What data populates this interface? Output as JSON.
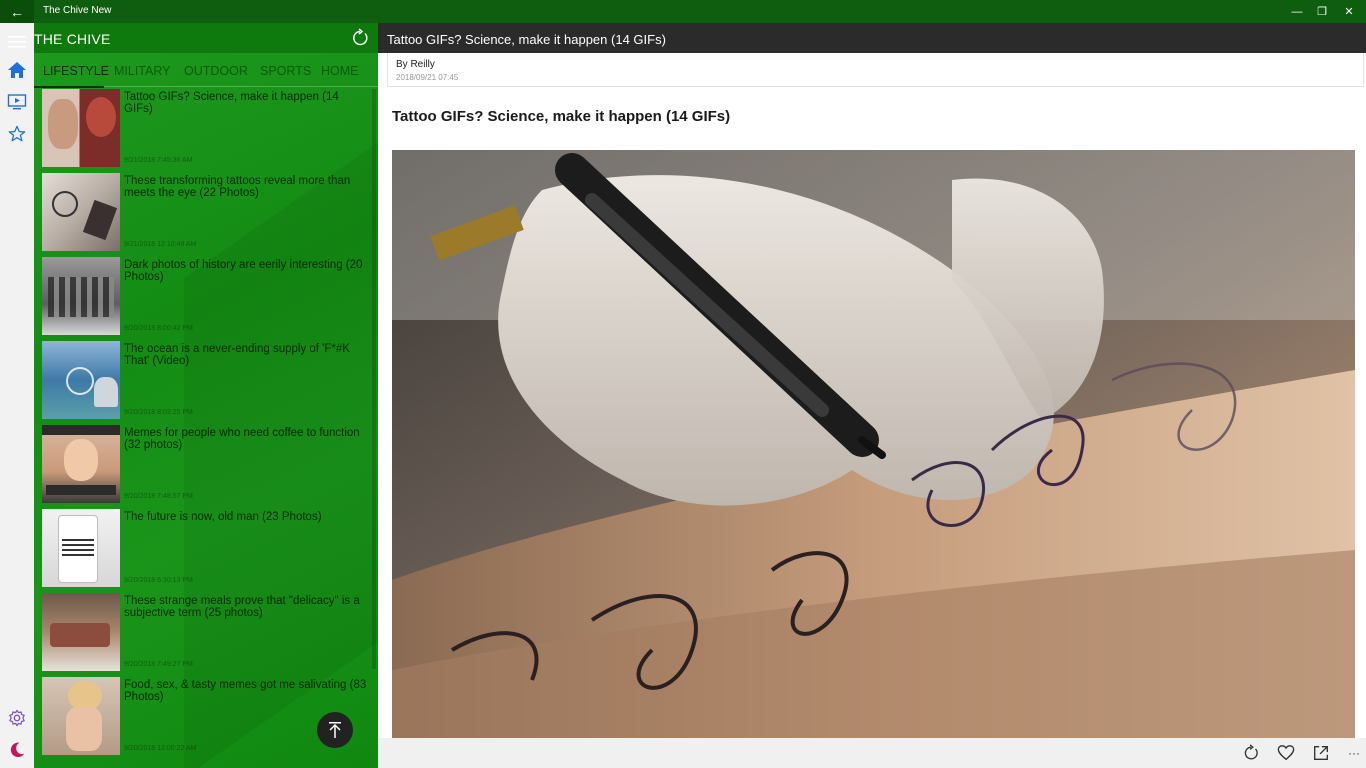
{
  "window": {
    "title": "The Chive New",
    "back_glyph": "←",
    "minimize_glyph": "—",
    "restore_glyph": "❐",
    "close_glyph": "✕"
  },
  "rail": {
    "icons": [
      "home-icon",
      "video-icon",
      "star-icon",
      "settings-icon",
      "moon-icon"
    ],
    "accent": "#1e6fd9",
    "moon_color": "#c2185b"
  },
  "list": {
    "brand": "THE CHIVE",
    "tabs": [
      "LIFESTYLE",
      "MILITARY",
      "OUTDOOR",
      "SPORTS",
      "HOME"
    ],
    "items": [
      {
        "title": "Tattoo GIFs? Science, make it happen (14 GIFs)",
        "date": "9/21/2018 7:45:36 AM"
      },
      {
        "title": "These transforming tattoos reveal more than meets the eye (22 Photos)",
        "date": "9/21/2018 12:10:49 AM"
      },
      {
        "title": "Dark photos of history are eerily interesting (20 Photos)",
        "date": "9/20/2018 8:00:42 PM"
      },
      {
        "title": "The ocean is a never-ending supply of 'F*#K That' (Video)",
        "date": "9/20/2018 8:03:25 PM"
      },
      {
        "title": "Memes for people who need coffee to function (32 photos)",
        "date": "9/20/2018 7:48:57 PM"
      },
      {
        "title": "The future is now, old man (23 Photos)",
        "date": "9/20/2018 6:30:13 PM"
      },
      {
        "title": "These strange meals prove that \"delicacy\" is a subjective term (25 photos)",
        "date": "9/20/2018 7:49:27 PM"
      },
      {
        "title": "Food, sex, & tasty memes got me salivating (83 Photos)",
        "date": "9/20/2018 12:00:22 AM"
      }
    ]
  },
  "article": {
    "header_title": "Tattoo GIFs? Science, make it happen (14 GIFs)",
    "byline": "By Reilly",
    "date": "2018/09/21 07:45",
    "title": "Tattoo GIFs? Science, make it happen (14 GIFs)",
    "more_glyph": "···"
  }
}
